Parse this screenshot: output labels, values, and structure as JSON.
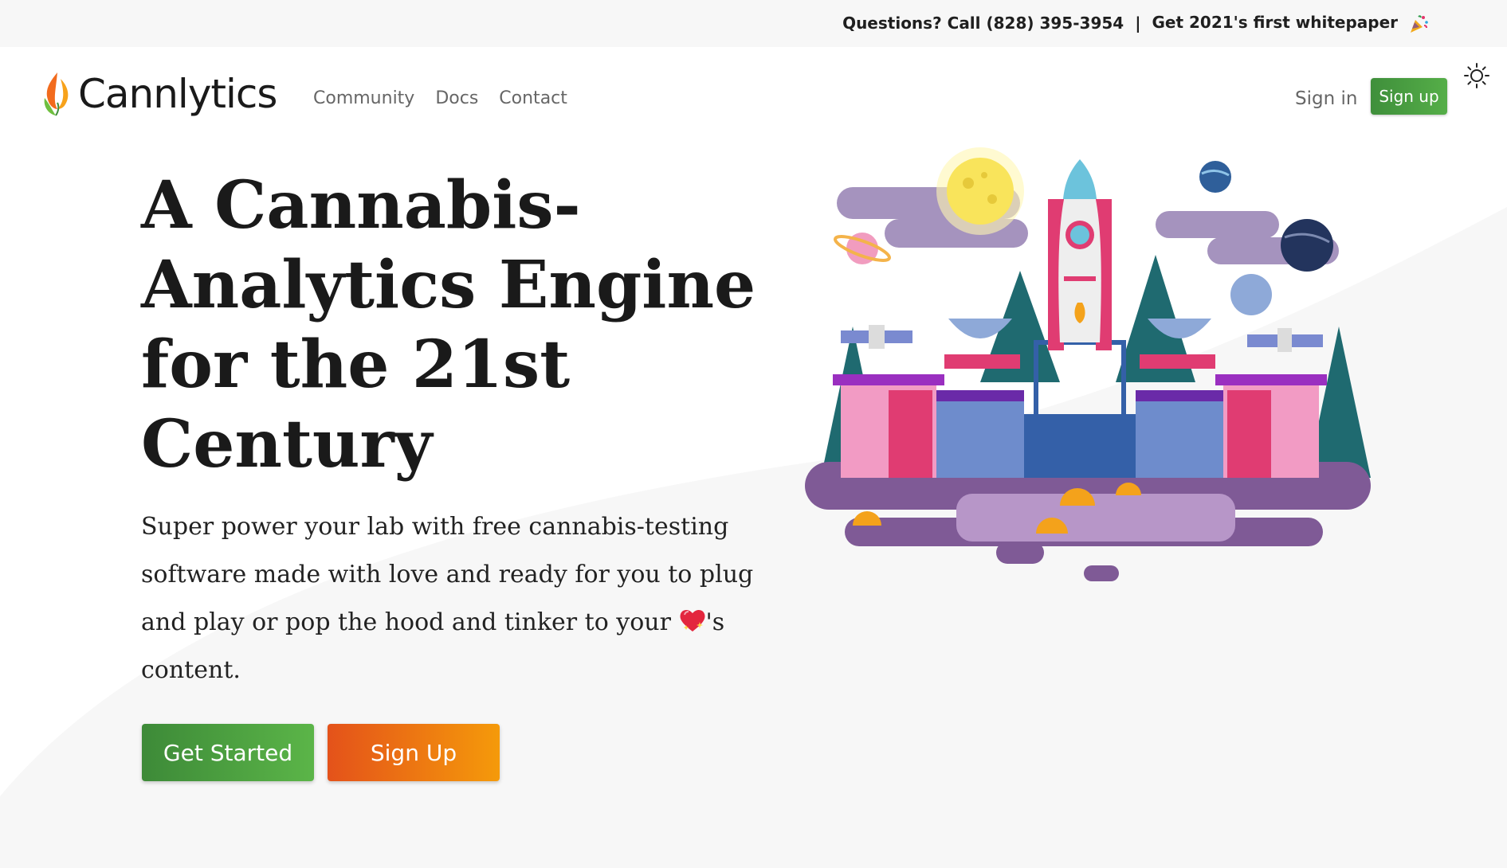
{
  "topbar": {
    "questions": "Questions? Call (828) 395-3954",
    "separator": "|",
    "whitepaper": "Get 2021's first whitepaper",
    "whitepaper_icon": "party-popper-icon"
  },
  "nav": {
    "brand": "Cannlytics",
    "links": [
      {
        "label": "Community"
      },
      {
        "label": "Docs"
      },
      {
        "label": "Contact"
      }
    ],
    "sign_in": "Sign in",
    "sign_up": "Sign up",
    "theme_icon": "sun-icon"
  },
  "hero": {
    "title": "A Cannabis-Analytics Engine for the 21st Century",
    "subtitle_before": "Super power your lab with free cannabis-testing software made with love and ready for you to plug and play or pop the hood and tinker to your ",
    "subtitle_icon": "sparkling-heart-icon",
    "subtitle_after": "'s content.",
    "cta_primary": "Get Started",
    "cta_secondary": "Sign Up"
  },
  "colors": {
    "green": "#4a9e3f",
    "orange": "#ef7a12",
    "background": "#f7f7f7"
  },
  "illustration": "rocket-launch-illustration"
}
